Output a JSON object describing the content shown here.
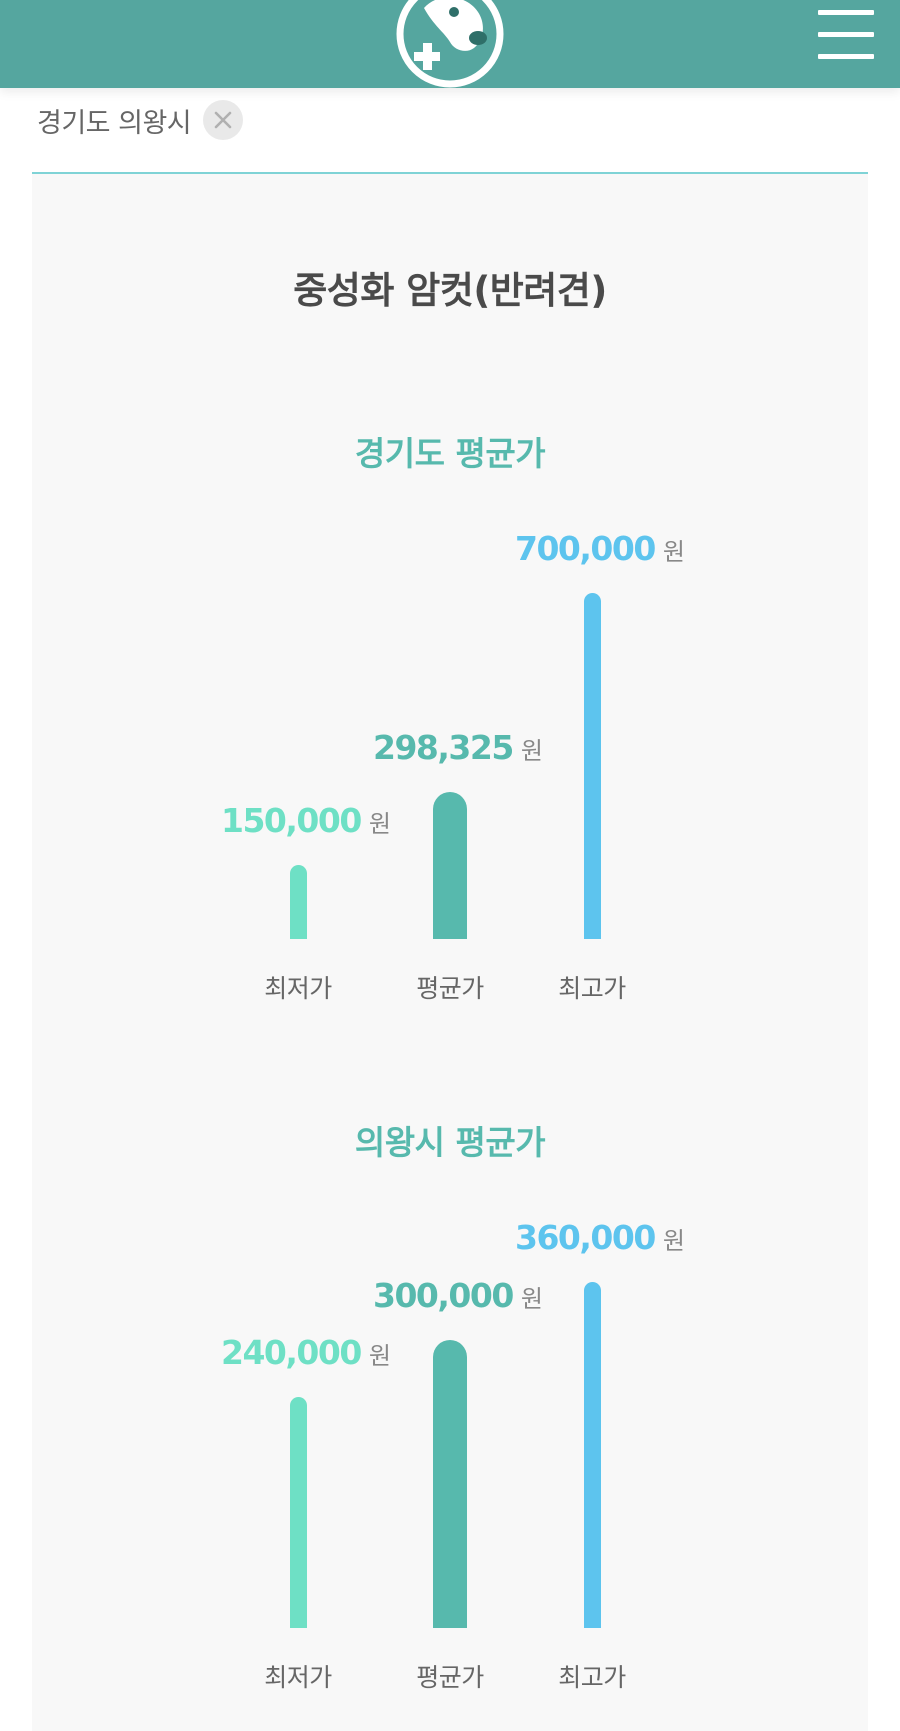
{
  "colors": {
    "brand": "#55a69f",
    "min": "#6ee0c5",
    "avg": "#57b9ad",
    "max": "#5dc4ee",
    "divider": "#7fd3d6"
  },
  "header": {
    "logo_icon": "dog-medical-cross-icon",
    "menu_icon": "hamburger-menu-icon"
  },
  "filter": {
    "label": "경기도 의왕시",
    "remove_icon": "close-icon"
  },
  "panel": {
    "title": "중성화 암컷(반려견)"
  },
  "unit": "원",
  "chart_data": [
    {
      "type": "bar",
      "title": "경기도 평균가",
      "categories": [
        "최저가",
        "평균가",
        "최고가"
      ],
      "values": [
        150000,
        298325,
        700000
      ],
      "value_labels": [
        "150,000",
        "298,325",
        "700,000"
      ],
      "ylim": [
        0,
        700000
      ],
      "grid": false,
      "legend": "none"
    },
    {
      "type": "bar",
      "title": "의왕시 평균가",
      "categories": [
        "최저가",
        "평균가",
        "최고가"
      ],
      "values": [
        240000,
        300000,
        360000
      ],
      "value_labels": [
        "240,000",
        "300,000",
        "360,000"
      ],
      "ylim": [
        0,
        360000
      ],
      "grid": false,
      "legend": "none"
    }
  ]
}
